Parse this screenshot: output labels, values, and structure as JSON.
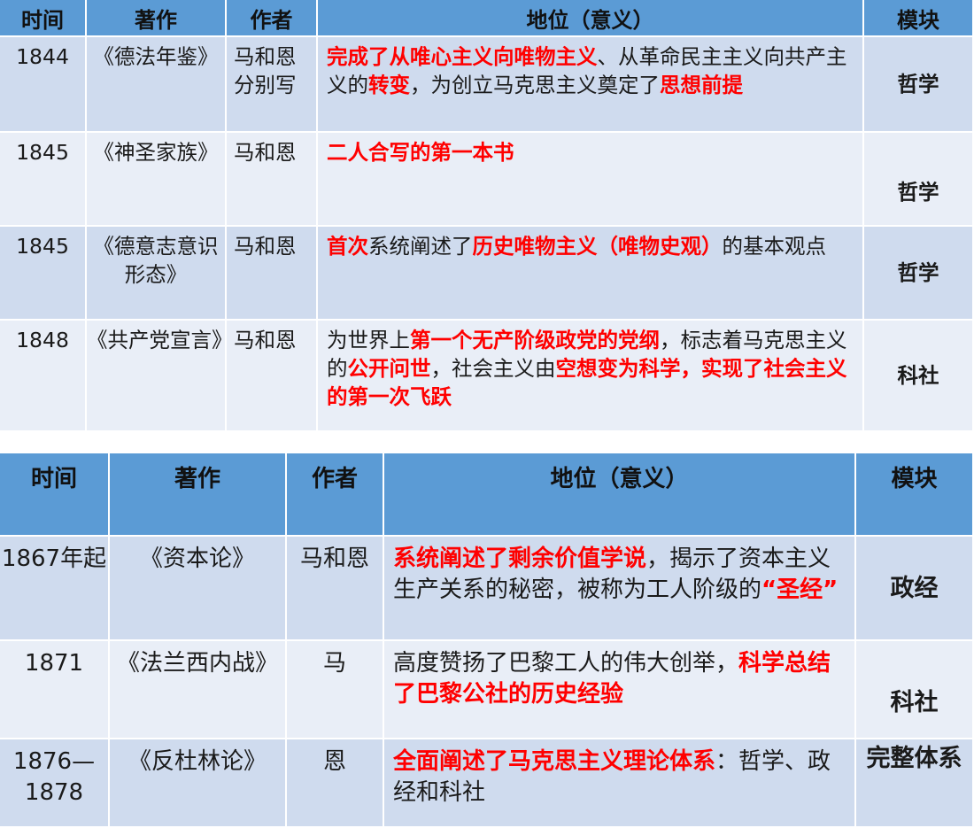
{
  "table1": {
    "headers": [
      "时间",
      "著作",
      "作者",
      "地位（意义）",
      "模块"
    ],
    "rows": [
      {
        "time": "1844",
        "work": "《德法年鉴》",
        "author": "马和恩分别写",
        "significance": [
          {
            "t": "完成了从唯心主义向唯物主义",
            "red": true
          },
          {
            "t": "、从革命民主主义向共产主义的",
            "red": false
          },
          {
            "t": "转变",
            "red": true
          },
          {
            "t": "，为创立马克思主义奠定了",
            "red": false
          },
          {
            "t": "思想前提",
            "red": true
          }
        ],
        "module": "哲学"
      },
      {
        "time": "1845",
        "work": "《神圣家族》",
        "author": "马和恩",
        "significance": [
          {
            "t": "二人合写的第一本书",
            "red": true
          }
        ],
        "module": "哲学"
      },
      {
        "time": "1845",
        "work": "《德意志意识形态》",
        "author": "马和恩",
        "significance": [
          {
            "t": "首次",
            "red": true
          },
          {
            "t": "系统阐述了",
            "red": false
          },
          {
            "t": "历史唯物主义（唯物史观）",
            "red": true
          },
          {
            "t": "的基本观点",
            "red": false
          }
        ],
        "module": "哲学"
      },
      {
        "time": "1848",
        "work": "《共产党宣言》",
        "author": "马和恩",
        "significance": [
          {
            "t": "为世界上",
            "red": false
          },
          {
            "t": "第一个无产阶级政党的党纲",
            "red": true
          },
          {
            "t": "，标志着马克思主义的",
            "red": false
          },
          {
            "t": "公开问世",
            "red": true
          },
          {
            "t": "，社会主义由",
            "red": false
          },
          {
            "t": "空想变为科学，实现了社会主义的第一次飞跃",
            "red": true
          }
        ],
        "module": "科社"
      }
    ]
  },
  "table2": {
    "headers": [
      "时间",
      "著作",
      "作者",
      "地位（意义）",
      "模块"
    ],
    "rows": [
      {
        "time": "1867年起",
        "work": "《资本论》",
        "author": "马和恩",
        "significance": [
          {
            "t": "系统阐述了剩余价值学说",
            "red": true
          },
          {
            "t": "，揭示了资本主义生产关系的秘密，被称为工人阶级的",
            "red": false
          },
          {
            "t": "“圣经”",
            "red": true
          }
        ],
        "module": "政经"
      },
      {
        "time": "1871",
        "work": "《法兰西内战》",
        "author": "马",
        "significance": [
          {
            "t": "高度赞扬了巴黎工人的伟大创举，",
            "red": false
          },
          {
            "t": "科学总结了巴黎公社的历史经验",
            "red": true
          }
        ],
        "module": "科社"
      },
      {
        "time": "1876—1878",
        "work": "《反杜林论》",
        "author": "恩",
        "significance": [
          {
            "t": "全面阐述了马克思主义理论体系",
            "red": true
          },
          {
            "t": "：哲学、政经和科社",
            "red": false
          }
        ],
        "module": "完整体系"
      }
    ]
  }
}
